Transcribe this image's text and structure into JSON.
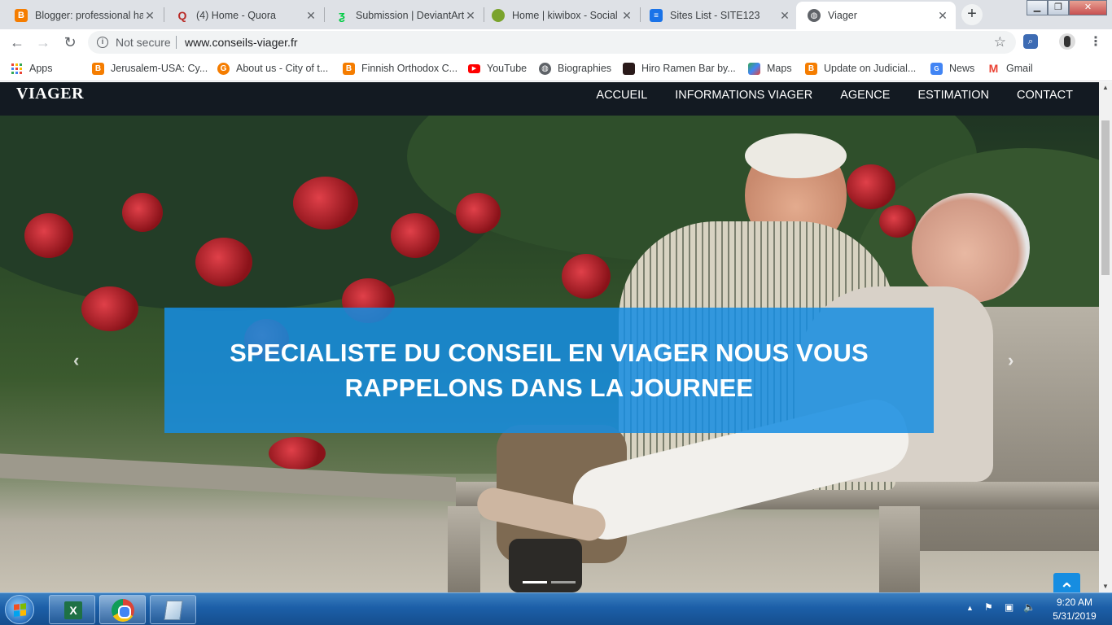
{
  "browser": {
    "tabs": [
      {
        "title": "Blogger: professional ha",
        "favicon": "blogger-icon",
        "color": "#f57d00"
      },
      {
        "title": "(4) Home - Quora",
        "favicon": "quora-icon",
        "color": "#b92b27"
      },
      {
        "title": "Submission | DeviantArt",
        "favicon": "deviantart-icon",
        "color": "#05cc47"
      },
      {
        "title": "Home | kiwibox - Social",
        "favicon": "kiwibox-icon",
        "color": "#7aa32c"
      },
      {
        "title": "Sites List - SITE123",
        "favicon": "site123-icon",
        "color": "#1a73e8"
      },
      {
        "title": "Viager",
        "favicon": "globe-icon",
        "color": "#5f6368"
      }
    ],
    "new_tab_label": "+",
    "address_bar": {
      "security_label": "Not secure",
      "url": "www.conseils-viager.fr"
    },
    "bookmarks": [
      {
        "label": "Apps",
        "icon": "apps-grid-icon"
      },
      {
        "label": "Jerusalem-USA: Cy...",
        "icon": "blogger-icon"
      },
      {
        "label": "About us - City of t...",
        "icon": "g-icon"
      },
      {
        "label": "Finnish Orthodox C...",
        "icon": "blogger-icon"
      },
      {
        "label": "YouTube",
        "icon": "youtube-icon"
      },
      {
        "label": "Biographies",
        "icon": "globe-icon"
      },
      {
        "label": "Hiro Ramen Bar by...",
        "icon": "hiro-icon"
      },
      {
        "label": "Maps",
        "icon": "maps-icon"
      },
      {
        "label": "Update on Judicial...",
        "icon": "blogger-icon"
      },
      {
        "label": "News",
        "icon": "news-icon"
      },
      {
        "label": "Gmail",
        "icon": "gmail-icon"
      }
    ]
  },
  "site": {
    "logo": "VIAGER",
    "nav": [
      "ACCUEIL",
      "INFORMATIONS VIAGER",
      "AGENCE",
      "ESTIMATION",
      "CONTACT"
    ],
    "hero_caption": "SPECIALISTE DU CONSEIL EN VIAGER NOUS VOUS RAPPELONS DANS LA JOURNEE",
    "accent_color": "#168de1",
    "carousel_slides": 2,
    "active_slide": 1
  },
  "taskbar": {
    "pinned": [
      "excel-icon",
      "chrome-icon",
      "notepad-icon"
    ],
    "time": "9:20 AM",
    "date": "5/31/2019"
  }
}
